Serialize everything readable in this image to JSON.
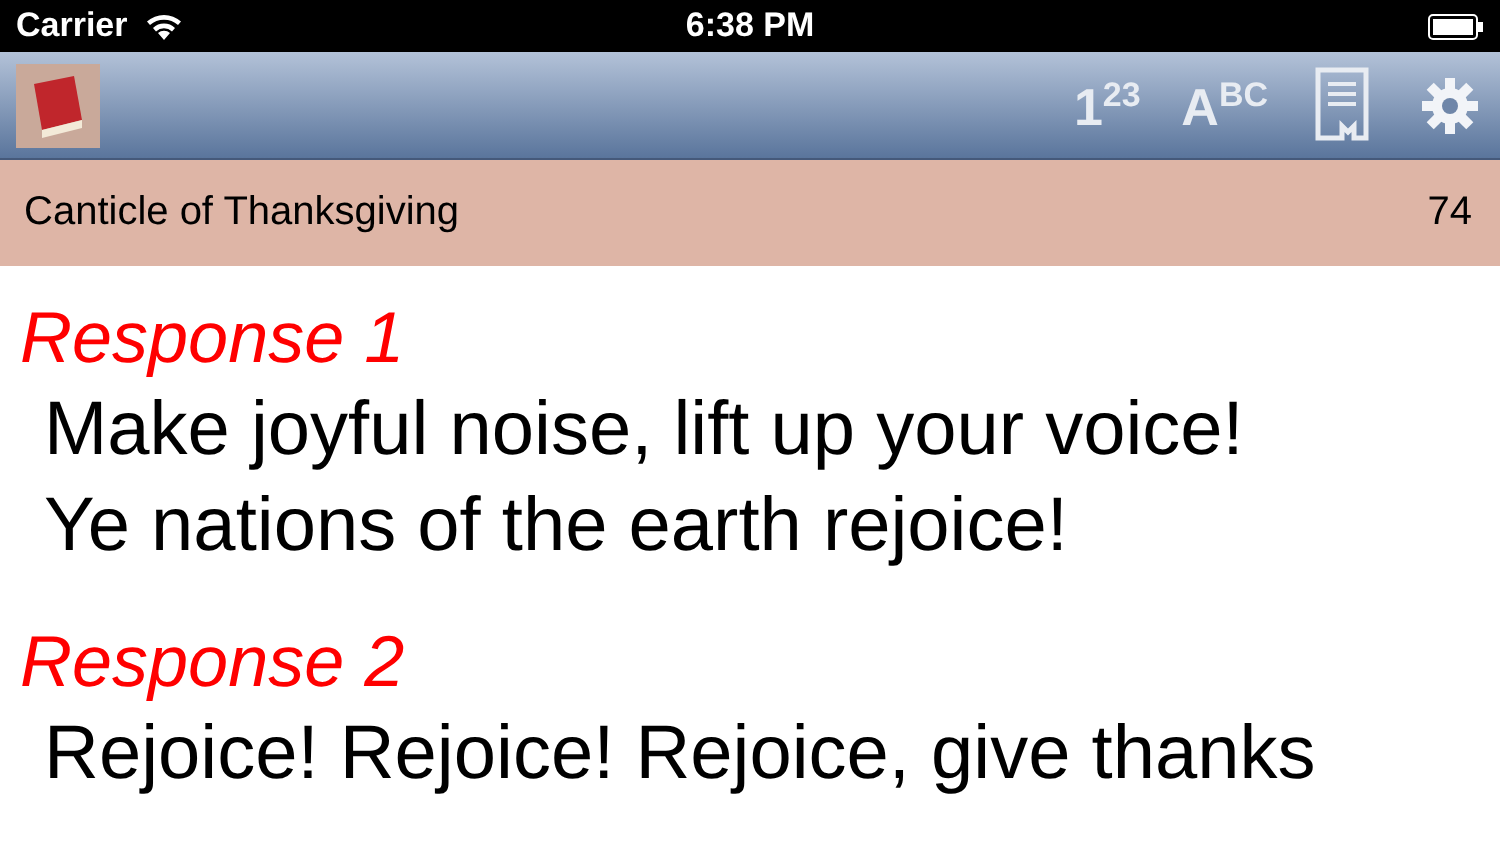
{
  "status_bar": {
    "carrier": "Carrier",
    "time": "6:38 PM"
  },
  "toolbar": {
    "buttons": [
      {
        "kind": "glyph",
        "label": "1$^{2}$$^{3}$"
      },
      {
        "kind": "glyph",
        "label": "A$^{B}$$^{C}$"
      },
      {
        "kind": "bookmark"
      },
      {
        "kind": "settings"
      }
    ]
  },
  "header": {
    "title": "Canticle of Thanksgiving",
    "number": "74"
  },
  "stanzas": [
    {
      "heading": "Response 1",
      "lines": [
        "Make joyful noise, lift up your voice!",
        "Ye nations of the earth rejoice!"
      ]
    },
    {
      "heading": "Response 2",
      "lines": [
        "Rejoice! Rejoice! Rejoice, give thanks"
      ]
    }
  ]
}
